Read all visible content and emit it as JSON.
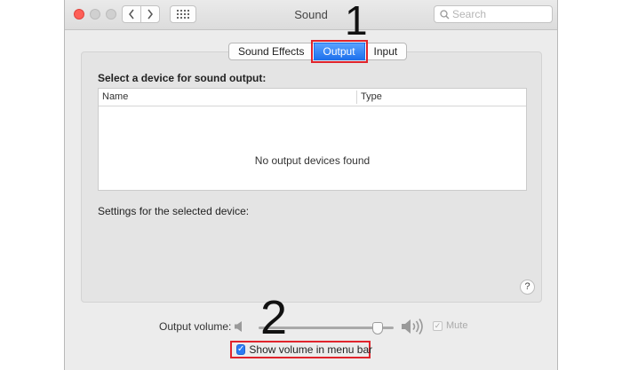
{
  "window": {
    "title": "Sound",
    "search_placeholder": "Search"
  },
  "tabs": [
    {
      "label": "Sound Effects",
      "active": false
    },
    {
      "label": "Output",
      "active": true
    },
    {
      "label": "Input",
      "active": false
    }
  ],
  "output": {
    "heading": "Select a device for sound output:",
    "table": {
      "columns": [
        "Name",
        "Type"
      ],
      "empty_message": "No output devices found"
    },
    "settings_label": "Settings for the selected device:",
    "help_label": "?"
  },
  "volume": {
    "label": "Output volume:",
    "level": 0.88,
    "mute_label": "Mute",
    "mute_checked": true,
    "mute_enabled": false
  },
  "menubar_option": {
    "label": "Show volume in menu bar",
    "checked": true
  },
  "annotations": {
    "step1": "1",
    "step2": "2",
    "highlight_color": "#e0242c"
  },
  "colors": {
    "accent": "#2b7bf3",
    "close_button": "#fe5f57"
  }
}
